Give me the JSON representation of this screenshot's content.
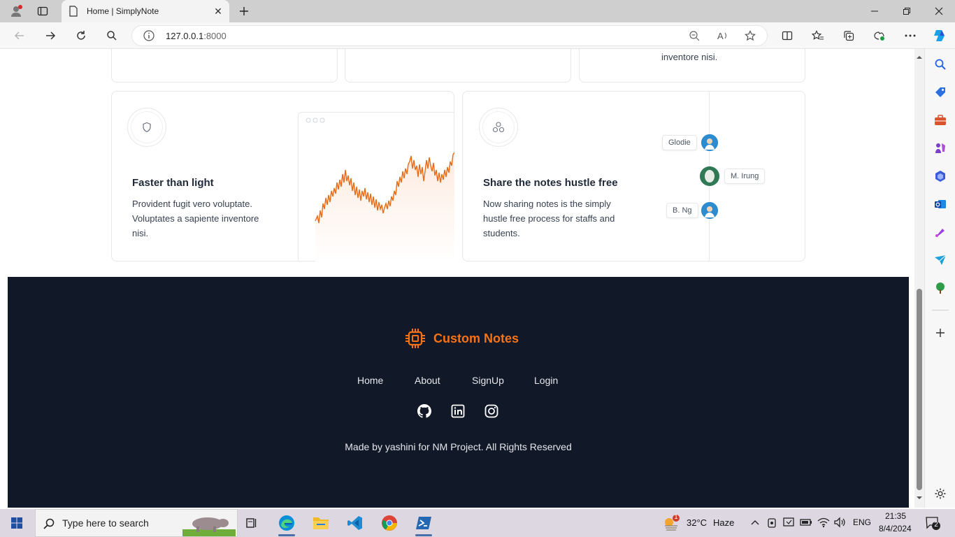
{
  "browser": {
    "tab_title": "Home | SimplyNote",
    "url_host": "127.0.0.1",
    "url_port": ":8000"
  },
  "cards_top": {
    "right_text": "inventore nisi."
  },
  "card_speed": {
    "heading": "Faster than light",
    "desc_line1": "Provident fugit vero voluptate.",
    "desc_line2": "Voluptates a sapiente inventore",
    "desc_line3": "nisi."
  },
  "card_share": {
    "heading": "Share the notes hustle free",
    "desc_line1": "Now sharing notes is the simply",
    "desc_line2": "hustle free process for staffs and",
    "desc_line3": "students.",
    "people": [
      "Glodie",
      "M. Irung",
      "B. Ng"
    ]
  },
  "footer": {
    "brand": "Custom Notes",
    "links": [
      "Home",
      "About",
      "SignUp",
      "Login"
    ],
    "copyright": "Made by yashini for NM Project. All Rights Reserved",
    "accent": "#f97316",
    "background": "#111827"
  },
  "taskbar": {
    "search_placeholder": "Type here to search",
    "weather_temp": "32°C",
    "weather_text": "Haze",
    "lang": "ENG",
    "time": "21:35",
    "date": "8/4/2024",
    "notif_count": "2",
    "weather_badge": "1"
  }
}
